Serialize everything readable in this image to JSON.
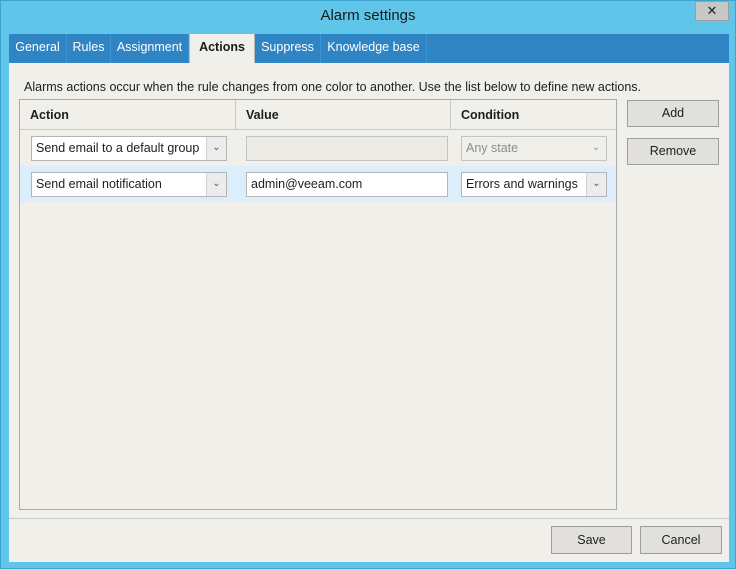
{
  "window": {
    "title": "Alarm settings",
    "close_glyph": "✕"
  },
  "tabs": [
    {
      "label": "General"
    },
    {
      "label": "Rules"
    },
    {
      "label": "Assignment"
    },
    {
      "label": "Actions"
    },
    {
      "label": "Suppress"
    },
    {
      "label": "Knowledge base"
    }
  ],
  "active_tab": "Actions",
  "hint": "Alarms actions occur when the rule changes from one color to another. Use the list below to define new actions.",
  "grid": {
    "columns": [
      "Action",
      "Value",
      "Condition"
    ],
    "rows": [
      {
        "action": "Send email to a default group",
        "value": "",
        "condition": "Any state"
      },
      {
        "action": "Send email notification",
        "value": "admin@veeam.com",
        "condition": "Errors and warnings"
      }
    ]
  },
  "side_buttons": {
    "add": "Add",
    "remove": "Remove"
  },
  "footer": {
    "save": "Save",
    "cancel": "Cancel"
  },
  "icons": {
    "dropdown": "chevron-down-icon",
    "close": "close-icon"
  },
  "colors": {
    "title_bar": "#5fc6ea",
    "tab_strip": "#2f84c4",
    "selected_row": "#dceefb"
  }
}
